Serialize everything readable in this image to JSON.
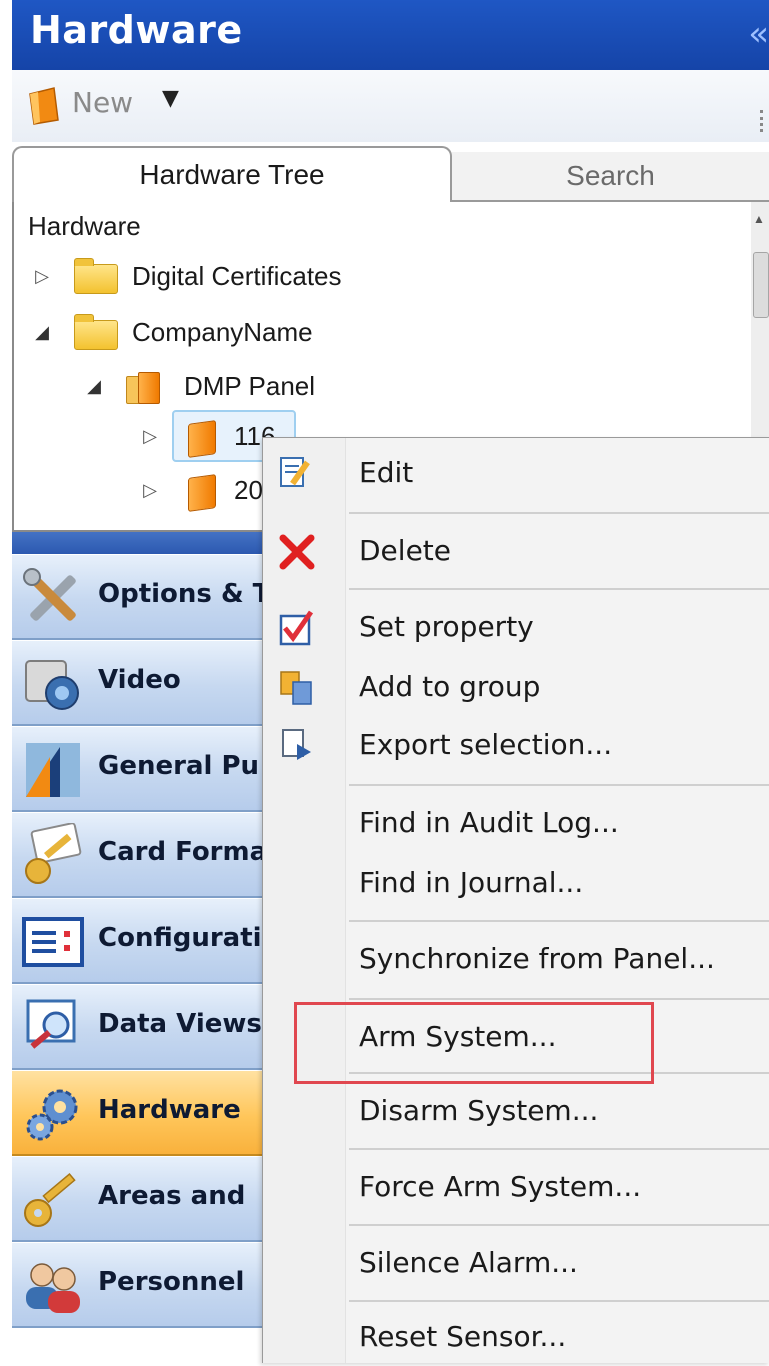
{
  "window": {
    "title": "Hardware",
    "collapse_glyph": "«"
  },
  "toolbar": {
    "new_label": "New",
    "new_dropdown_glyph": "▼"
  },
  "tabs": [
    {
      "label": "Hardware Tree",
      "active": true
    },
    {
      "label": "Search",
      "active": false
    }
  ],
  "tree": {
    "root": "Hardware",
    "nodes": [
      {
        "label": "Digital Certificates",
        "expanded": false,
        "icon": "folder-icon"
      },
      {
        "label": "CompanyName",
        "expanded": true,
        "icon": "folder-icon"
      },
      {
        "label": "DMP Panel",
        "expanded": true,
        "icon": "panel-group-icon"
      },
      {
        "label": "116",
        "expanded": false,
        "icon": "panel-icon",
        "selected": true
      },
      {
        "label": "20",
        "expanded": false,
        "icon": "panel-icon"
      }
    ],
    "expander_closed": "▷",
    "expander_open": "◢"
  },
  "nav": {
    "items": [
      {
        "label": "Options & T",
        "icon": "tools-icon",
        "active": false
      },
      {
        "label": "Video",
        "icon": "camera-icon",
        "active": false
      },
      {
        "label": "General Pu",
        "icon": "general-purpose-icon",
        "active": false
      },
      {
        "label": "Card Forma",
        "icon": "card-key-icon",
        "active": false
      },
      {
        "label": "Configurati",
        "icon": "configuration-icon",
        "active": false
      },
      {
        "label": "Data Views",
        "icon": "data-views-icon",
        "active": false
      },
      {
        "label": "Hardware",
        "icon": "hardware-gears-icon",
        "active": true
      },
      {
        "label": "Areas and",
        "icon": "key-icon",
        "active": false
      },
      {
        "label": "Personnel",
        "icon": "people-icon",
        "active": false
      }
    ]
  },
  "context_menu": {
    "items": [
      {
        "label": "Edit",
        "icon": "edit-icon"
      },
      {
        "label": "Delete",
        "icon": "delete-icon"
      },
      {
        "label": "Set property",
        "icon": "set-property-icon"
      },
      {
        "label": "Add to group",
        "icon": "add-to-group-icon"
      },
      {
        "label": "Export selection...",
        "icon": "export-icon"
      },
      {
        "label": "Find in Audit Log...",
        "icon": ""
      },
      {
        "label": "Find in Journal...",
        "icon": ""
      },
      {
        "label": "Synchronize from Panel...",
        "icon": ""
      },
      {
        "label": "Arm System...",
        "icon": "",
        "highlighted": true
      },
      {
        "label": "Disarm System...",
        "icon": ""
      },
      {
        "label": "Force Arm System...",
        "icon": ""
      },
      {
        "label": "Silence Alarm...",
        "icon": ""
      },
      {
        "label": "Reset Sensor...",
        "icon": ""
      }
    ]
  },
  "colors": {
    "title_bar": "#1f57c4",
    "highlight_box": "#e0474f",
    "nav_active": "#ffc65a"
  }
}
